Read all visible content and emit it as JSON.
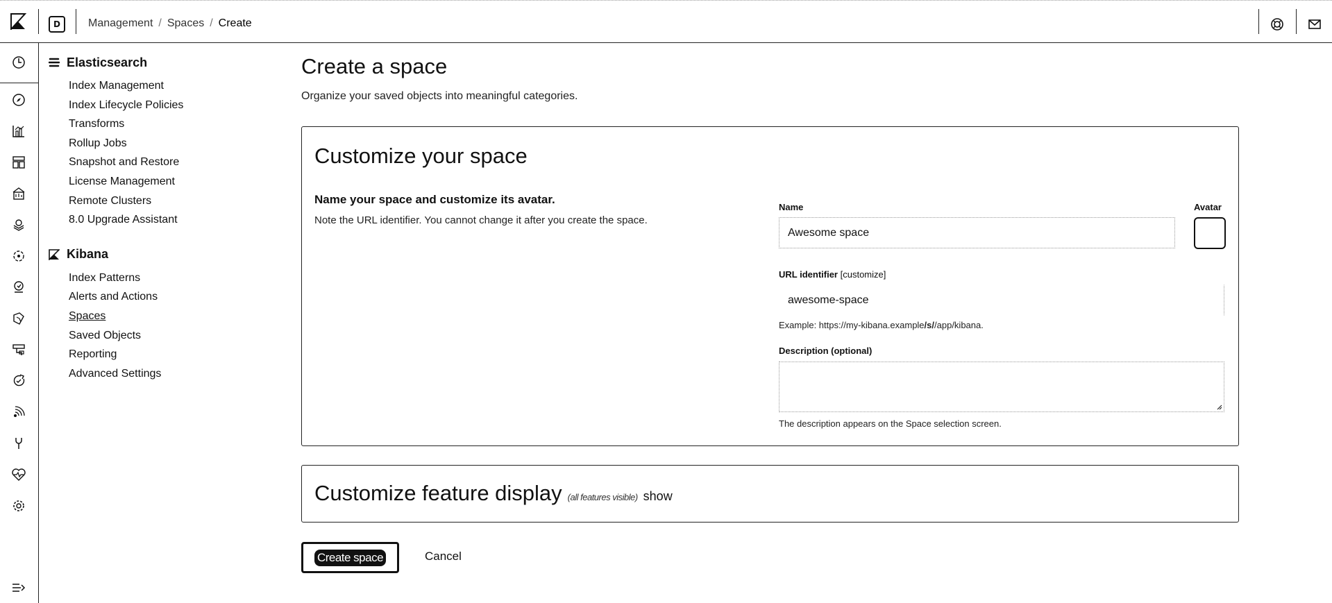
{
  "header": {
    "space_initial": "D",
    "breadcrumbs": [
      "Management",
      "Spaces",
      "Create"
    ],
    "separator": "/"
  },
  "rail_icons": [
    "recent-icon",
    "discover-icon",
    "visualize-icon",
    "dashboard-icon",
    "canvas-icon",
    "maps-icon",
    "ml-icon",
    "siem-icon",
    "logs-icon",
    "metrics-icon",
    "apm-icon",
    "uptime-icon",
    "dev-tools-icon",
    "stack-monitoring-icon",
    "management-icon",
    "collapse-icon"
  ],
  "sidemenu": {
    "elasticsearch": {
      "title": "Elasticsearch",
      "items": [
        "Index Management",
        "Index Lifecycle Policies",
        "Transforms",
        "Rollup Jobs",
        "Snapshot and Restore",
        "License Management",
        "Remote Clusters",
        "8.0 Upgrade Assistant"
      ]
    },
    "kibana": {
      "title": "Kibana",
      "items": [
        "Index Patterns",
        "Alerts and Actions",
        "Spaces",
        "Saved Objects",
        "Reporting",
        "Advanced Settings"
      ],
      "active": "Spaces"
    }
  },
  "main": {
    "title": "Create a space",
    "subtitle": "Organize your saved objects into meaningful categories.",
    "customize": {
      "title": "Customize your space",
      "heading": "Name your space and customize its avatar.",
      "text": "Note the URL identifier. You cannot change it after you create the space.",
      "name_label": "Name",
      "name_value": "Awesome space",
      "avatar_label": "Avatar",
      "url_label": "URL identifier",
      "url_customize": "[customize]",
      "url_value": "awesome-space",
      "example_prefix": "Example: https://my-kibana.example",
      "example_bold": "/s/",
      "example_suffix": "/app/kibana.",
      "description_label": "Description (optional)",
      "description_help": "The description appears on the Space selection screen."
    },
    "features": {
      "title": "Customize feature display",
      "visible_note": "(all features visible)",
      "show_link": "show"
    },
    "buttons": {
      "create": "Create space",
      "cancel": "Cancel"
    }
  },
  "colors": {
    "border": "#222222",
    "text": "#111111"
  }
}
